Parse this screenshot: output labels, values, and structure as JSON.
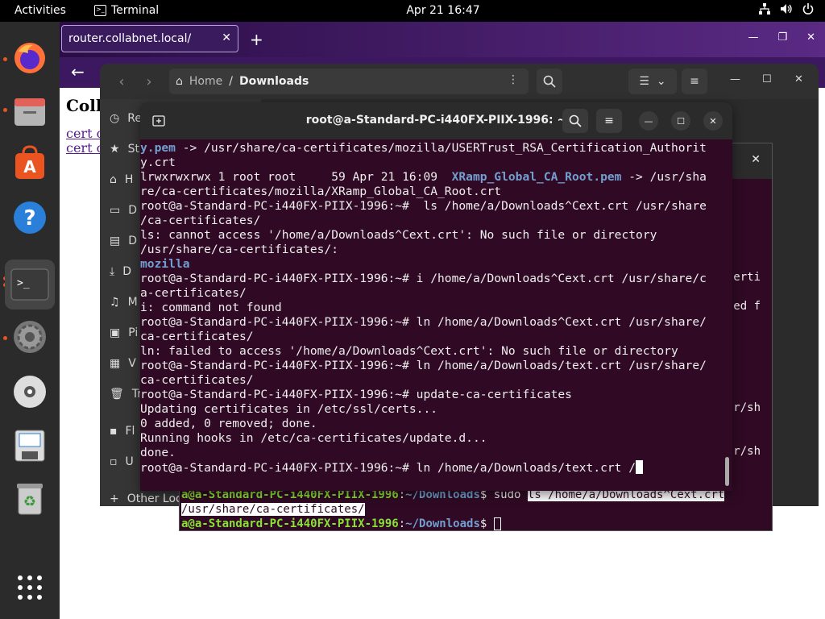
{
  "topbar": {
    "activities": "Activities",
    "app_name": "Terminal",
    "clock": "Apr 21  16:47",
    "tray": [
      "network-icon",
      "volume-icon",
      "power-icon"
    ]
  },
  "dock": {
    "items": [
      {
        "name": "firefox-icon",
        "running": true
      },
      {
        "name": "files-icon",
        "running": true
      },
      {
        "name": "app-center-icon",
        "running": false
      },
      {
        "name": "help-icon",
        "running": false
      },
      {
        "name": "terminal-icon",
        "running": true,
        "active": true
      },
      {
        "name": "settings-icon",
        "running": true
      },
      {
        "name": "disc-icon",
        "running": false
      },
      {
        "name": "save-icon",
        "running": false
      },
      {
        "name": "trash-icon",
        "running": false
      },
      {
        "name": "show-apps-icon",
        "running": false
      }
    ]
  },
  "browser": {
    "tab_title": "router.collabnet.local/",
    "tab_close": "✕",
    "new_tab": "+",
    "heading": "Coll",
    "links": [
      "cert c",
      "cert c"
    ]
  },
  "files": {
    "path_home": "Home",
    "path_sep": "/",
    "path_current": "Downloads",
    "sidebar": [
      {
        "icon": "recent-icon",
        "label": "Re"
      },
      {
        "icon": "starred-icon",
        "label": "St"
      },
      {
        "icon": "home-icon",
        "label": "H"
      },
      {
        "icon": "desktop-icon",
        "label": "D"
      },
      {
        "icon": "documents-icon",
        "label": "D"
      },
      {
        "icon": "downloads-icon",
        "label": "D"
      },
      {
        "icon": "music-icon",
        "label": "M"
      },
      {
        "icon": "pictures-icon",
        "label": "Pi"
      },
      {
        "icon": "videos-icon",
        "label": "V"
      },
      {
        "icon": "trash-icon",
        "label": "Tr"
      },
      {
        "icon": "floppy-icon",
        "label": "Fl"
      },
      {
        "icon": "usb-icon",
        "label": "U"
      },
      {
        "icon": "plus-icon",
        "label": "Other Loc"
      }
    ]
  },
  "terminal2": {
    "side_fragments": [
      "erti",
      "ed f",
      "r/sh",
      "r/sh"
    ],
    "line1_prompt": "a@a-Standard-PC-i440FX-PIIX-1996",
    "line1_sep": ":",
    "line1_path": "~/Downloads",
    "line1_dollar": "$ sudo ",
    "line1_cmd": "ls /home/a/Downloads^Cext.crt",
    "line2_cmd": "/usr/share/ca-certificates/",
    "line3_prompt": "a@a-Standard-PC-i440FX-PIIX-1996",
    "line3_sep": ":",
    "line3_path": "~/Downloads",
    "line3_dollar": "$ "
  },
  "terminal": {
    "title": "root@a-Standard-PC-i440FX-PIIX-1996: ~",
    "lines": [
      {
        "pre": "",
        "blue": "y.pem",
        "post": " -> /usr/share/ca-certificates/mozilla/USERTrust_RSA_Certification_Authorit"
      },
      {
        "pre": "y.crt",
        "blue": "",
        "post": ""
      },
      {
        "pre": "lrwxrwxrwx 1 root root     59 Apr 21 16:09  ",
        "blue": "XRamp_Global_CA_Root.pem",
        "post": " -> /usr/sha"
      },
      {
        "pre": "re/ca-certificates/mozilla/XRamp_Global_CA_Root.crt",
        "blue": "",
        "post": ""
      },
      {
        "pre": "root@a-Standard-PC-i440FX-PIIX-1996:~#  ls /home/a/Downloads^Cext.crt /usr/share",
        "blue": "",
        "post": ""
      },
      {
        "pre": "/ca-certificates/",
        "blue": "",
        "post": ""
      },
      {
        "pre": "ls: cannot access '/home/a/Downloads^Cext.crt': No such file or directory",
        "blue": "",
        "post": ""
      },
      {
        "pre": "/usr/share/ca-certificates/:",
        "blue": "",
        "post": ""
      },
      {
        "pre": "",
        "blue": "mozilla",
        "post": ""
      },
      {
        "pre": "root@a-Standard-PC-i440FX-PIIX-1996:~# i /home/a/Downloads^Cext.crt /usr/share/c",
        "blue": "",
        "post": ""
      },
      {
        "pre": "a-certificates/",
        "blue": "",
        "post": ""
      },
      {
        "pre": "i: command not found",
        "blue": "",
        "post": ""
      },
      {
        "pre": "root@a-Standard-PC-i440FX-PIIX-1996:~# ln /home/a/Downloads^Cext.crt /usr/share/",
        "blue": "",
        "post": ""
      },
      {
        "pre": "ca-certificates/",
        "blue": "",
        "post": ""
      },
      {
        "pre": "ln: failed to access '/home/a/Downloads^Cext.crt': No such file or directory",
        "blue": "",
        "post": ""
      },
      {
        "pre": "root@a-Standard-PC-i440FX-PIIX-1996:~# ln /home/a/Downloads/text.crt /usr/share/",
        "blue": "",
        "post": ""
      },
      {
        "pre": "ca-certificates/",
        "blue": "",
        "post": ""
      },
      {
        "pre": "root@a-Standard-PC-i440FX-PIIX-1996:~# update-ca-certificates",
        "blue": "",
        "post": ""
      },
      {
        "pre": "Updating certificates in /etc/ssl/certs...",
        "blue": "",
        "post": ""
      },
      {
        "pre": "0 added, 0 removed; done.",
        "blue": "",
        "post": ""
      },
      {
        "pre": "Running hooks in /etc/ca-certificates/update.d...",
        "blue": "",
        "post": ""
      },
      {
        "pre": "done.",
        "blue": "",
        "post": ""
      },
      {
        "pre": "root@a-Standard-PC-i440FX-PIIX-1996:~# ln /home/a/Downloads/text.crt /",
        "blue": "",
        "post": "",
        "caret": true
      }
    ]
  }
}
